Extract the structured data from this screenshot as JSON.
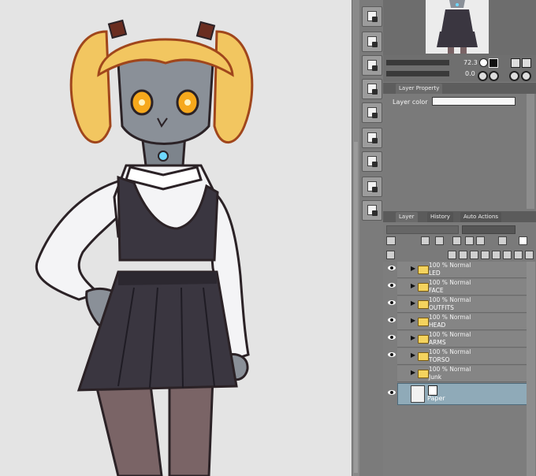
{
  "navigator": {
    "zoom": "72.3",
    "rotation": "0.0"
  },
  "layer_property": {
    "tab_label": "Layer Property",
    "layer_color_label": "Layer color"
  },
  "layer_panel": {
    "tab_layer": "Layer",
    "tab_history": "History",
    "tab_auto_actions": "Auto Actions",
    "layers": [
      {
        "opacity_mode": "100 % Normal",
        "name": "LED"
      },
      {
        "opacity_mode": "100 % Normal",
        "name": "FACE"
      },
      {
        "opacity_mode": "100 % Normal",
        "name": "OUTFITS"
      },
      {
        "opacity_mode": "100 % Normal",
        "name": "HEAD"
      },
      {
        "opacity_mode": "100 % Normal",
        "name": "ARMS"
      },
      {
        "opacity_mode": "100 % Normal",
        "name": "TORSO"
      },
      {
        "opacity_mode": "100 % Normal",
        "name": "Junk"
      }
    ],
    "paper_layer": "Paper"
  },
  "colors": {
    "canvas_bg": "#e4e4e4",
    "panel_bg": "#7a7a7a",
    "selected_layer": "#8faab8",
    "hair": "#f2c660",
    "dress": "#3a3640",
    "skin": "#8a9098",
    "led": "#6ed8ff"
  }
}
